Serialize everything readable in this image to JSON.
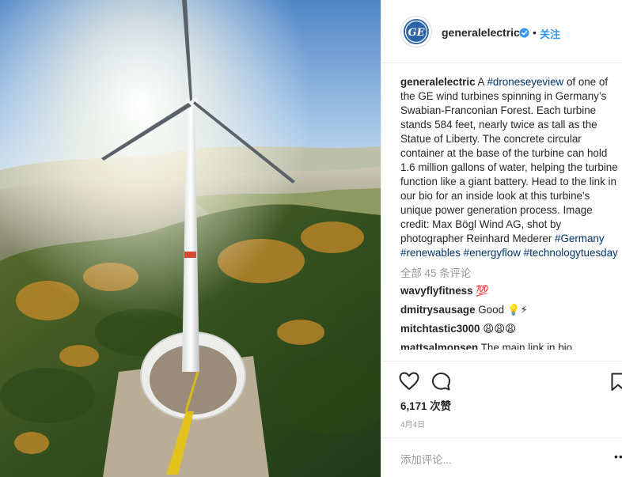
{
  "post": {
    "account": "generalelectric",
    "separator": "•",
    "follow_label": "关注",
    "caption": {
      "author": "generalelectric",
      "segments": [
        {
          "type": "text",
          "value": " A "
        },
        {
          "type": "tag",
          "value": "#droneseyeview"
        },
        {
          "type": "text",
          "value": " of one of the GE wind turbines spinning in Germany’s Swabian-Franconian Forest. Each turbine stands 584 feet, nearly twice as tall as the Statue of Liberty. The concrete circular container at the base of the turbine can hold 1.6 million gallons of water, helping the turbine function like a giant battery. Head to the link in our bio for an inside look at this turbine's unique power generation process. Image credit: Max Bögl Wind AG, shot by photographer Reinhard Mederer "
        },
        {
          "type": "tag",
          "value": "#Germany"
        },
        {
          "type": "text",
          "value": " "
        },
        {
          "type": "tag",
          "value": "#renewables"
        },
        {
          "type": "text",
          "value": " "
        },
        {
          "type": "tag",
          "value": "#energyflow"
        },
        {
          "type": "text",
          "value": " "
        },
        {
          "type": "tag",
          "value": "#technologytuesday"
        }
      ]
    },
    "all_comments_label": "全部 45 条评论",
    "comments": [
      {
        "user": "wavyflyfitness",
        "text": "💯"
      },
      {
        "user": "dmitrysausage",
        "text": "Good 💡⚡"
      },
      {
        "user": "mitchtastic3000",
        "text": "😩😩😩"
      },
      {
        "user": "mattsalmonsen",
        "text": "The main link in bio..."
      }
    ],
    "likes_label": "6,171 次赞",
    "date_label": "4月4日",
    "add_comment_placeholder": "添加评论...",
    "more_label": "•••"
  },
  "icons": {
    "avatar": "ge-logo-icon",
    "verified": "verified-badge-icon",
    "like": "heart-icon",
    "comment": "comment-icon",
    "save": "bookmark-icon",
    "more": "more-options-icon"
  },
  "colors": {
    "link": "#003569",
    "follow": "#3897f0",
    "muted": "#999999",
    "ge_blue": "#2e63a8"
  }
}
